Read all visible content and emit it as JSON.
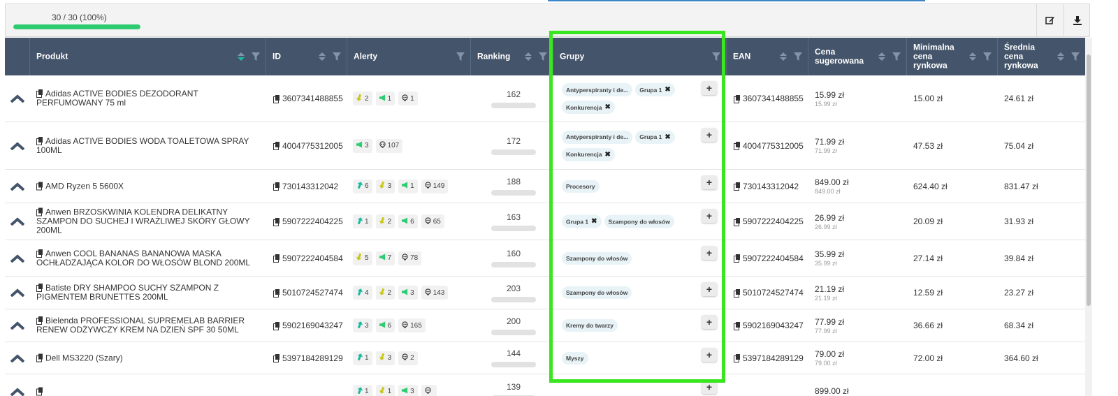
{
  "progress": {
    "text": "30 / 30 (100%)",
    "fraction": 1.0
  },
  "toolbar": {
    "edit_icon": "edit-icon",
    "download_icon": "download-icon"
  },
  "colors": {
    "header_bg": "#44546a",
    "progress": "#2ecc71",
    "highlight": "#39e61f",
    "teal": "#1abc9c"
  },
  "columns": [
    {
      "label": "Produkt"
    },
    {
      "label": "ID"
    },
    {
      "label": "Alerty"
    },
    {
      "label": "Ranking"
    },
    {
      "label": "Grupy"
    },
    {
      "label": "EAN"
    },
    {
      "label": "Cena sugerowana"
    },
    {
      "label": "Minimalna cena rynkowa"
    },
    {
      "label": "Średnia cena rynkowa"
    }
  ],
  "rows": [
    {
      "name": "Adidas ACTIVE BODIES DEZODORANT PERFUMOWANY 75 ml",
      "id": "3607341488855",
      "alerts": [
        {
          "type": "down",
          "value": "2"
        },
        {
          "type": "megaphone",
          "value": "1"
        },
        {
          "type": "skull",
          "value": "1"
        }
      ],
      "ranking": "162",
      "groups": [
        {
          "label": "Antyperspiranty i de...",
          "removable": false
        },
        {
          "label": "Grupa 1",
          "removable": true
        },
        {
          "label": "Konkurencja",
          "removable": true
        }
      ],
      "ean": "3607341488855",
      "price": "15.99 zł",
      "price_sub": "15.99 zł",
      "min": "15.00 zł",
      "avg": "24.61 zł"
    },
    {
      "name": "Adidas ACTIVE BODIES WODA TOALETOWA SPRAY 100ML",
      "id": "4004775312005",
      "alerts": [
        {
          "type": "megaphone",
          "value": "3"
        },
        {
          "type": "skull",
          "value": "107"
        }
      ],
      "ranking": "172",
      "groups": [
        {
          "label": "Antyperspiranty i de...",
          "removable": false
        },
        {
          "label": "Grupa 1",
          "removable": true
        },
        {
          "label": "Konkurencja",
          "removable": true
        }
      ],
      "ean": "4004775312005",
      "price": "71.99 zł",
      "price_sub": "71.99 zł",
      "min": "47.53 zł",
      "avg": "75.04 zł"
    },
    {
      "name": "AMD Ryzen 5 5600X",
      "id": "730143312042",
      "alerts": [
        {
          "type": "up",
          "value": "6"
        },
        {
          "type": "down",
          "value": "3"
        },
        {
          "type": "megaphone",
          "value": "1"
        },
        {
          "type": "skull",
          "value": "149"
        }
      ],
      "ranking": "188",
      "groups": [
        {
          "label": "Procesory",
          "removable": false
        }
      ],
      "ean": "730143312042",
      "price": "849.00 zł",
      "price_sub": "849.00 zł",
      "min": "624.40 zł",
      "avg": "831.47 zł"
    },
    {
      "name": "Anwen BRZOSKWINIA KOLENDRA DELIKATNY SZAMPON DO SUCHEJ I WRAŻLIWEJ SKÓRY GŁOWY 200ML",
      "id": "5907222404225",
      "alerts": [
        {
          "type": "up",
          "value": "1"
        },
        {
          "type": "down",
          "value": "2"
        },
        {
          "type": "megaphone",
          "value": "6"
        },
        {
          "type": "skull",
          "value": "65"
        }
      ],
      "ranking": "163",
      "groups": [
        {
          "label": "Grupa 1",
          "removable": true
        },
        {
          "label": "Szampony do włosów",
          "removable": false
        }
      ],
      "ean": "5907222404225",
      "price": "26.99 zł",
      "price_sub": "26.99 zł",
      "min": "20.09 zł",
      "avg": "31.93 zł"
    },
    {
      "name": "Anwen COOL BANANAS BANANOWA MASKA OCHŁADZAJĄCA KOLOR DO WŁOSÓW BLOND 200ML",
      "id": "5907222404584",
      "alerts": [
        {
          "type": "down",
          "value": "5"
        },
        {
          "type": "megaphone",
          "value": "7"
        },
        {
          "type": "skull",
          "value": "78"
        }
      ],
      "ranking": "160",
      "groups": [
        {
          "label": "Szampony do włosów",
          "removable": false
        }
      ],
      "ean": "5907222404584",
      "price": "35.99 zł",
      "price_sub": "35.99 zł",
      "min": "27.14 zł",
      "avg": "39.84 zł"
    },
    {
      "name": "Batiste DRY SHAMPOO SUCHY SZAMPON Z PIGMENTEM BRUNETTES 200ML",
      "id": "5010724527474",
      "alerts": [
        {
          "type": "up",
          "value": "4"
        },
        {
          "type": "down",
          "value": "2"
        },
        {
          "type": "megaphone",
          "value": "3"
        },
        {
          "type": "skull",
          "value": "143"
        }
      ],
      "ranking": "203",
      "groups": [
        {
          "label": "Szampony do włosów",
          "removable": false
        }
      ],
      "ean": "5010724527474",
      "price": "21.19 zł",
      "price_sub": "21.19 zł",
      "min": "12.59 zł",
      "avg": "23.27 zł"
    },
    {
      "name": "Bielenda PROFESSIONAL SUPREMELAB BARRIER RENEW ODŻYWCZY KREM NA DZIEŃ SPF 30 50ML",
      "id": "5902169043247",
      "alerts": [
        {
          "type": "up",
          "value": "3"
        },
        {
          "type": "megaphone",
          "value": "6"
        },
        {
          "type": "skull",
          "value": "165"
        }
      ],
      "ranking": "200",
      "groups": [
        {
          "label": "Kremy do twarzy",
          "removable": false
        }
      ],
      "ean": "5902169043247",
      "price": "77.99 zł",
      "price_sub": "77.99 zł",
      "min": "36.66 zł",
      "avg": "68.34 zł"
    },
    {
      "name": "Dell MS3220 (Szary)",
      "id": "5397184289129",
      "alerts": [
        {
          "type": "up",
          "value": "1"
        },
        {
          "type": "down",
          "value": "3"
        },
        {
          "type": "skull",
          "value": "2"
        }
      ],
      "ranking": "144",
      "groups": [
        {
          "label": "Myszy",
          "removable": false
        }
      ],
      "ean": "5397184289129",
      "price": "79.00 zł",
      "price_sub": "79.00 zł",
      "min": "72.00 zł",
      "avg": "364.60 zł"
    },
    {
      "name": "",
      "id": "",
      "alerts": [
        {
          "type": "up",
          "value": "1"
        },
        {
          "type": "down",
          "value": "1"
        },
        {
          "type": "megaphone",
          "value": "3"
        },
        {
          "type": "skull",
          "value": ""
        }
      ],
      "ranking": "139",
      "groups": [],
      "ean": "",
      "price": "899.00 zł",
      "price_sub": "",
      "min": "",
      "avg": ""
    }
  ]
}
